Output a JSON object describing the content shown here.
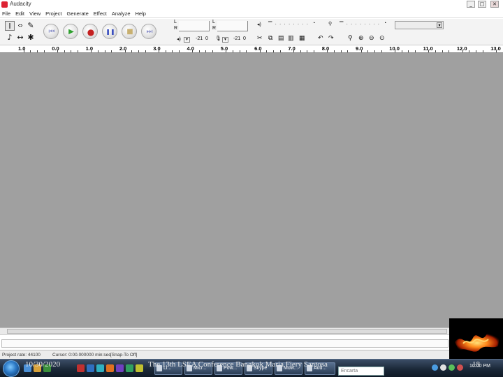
{
  "window": {
    "title": "Audacity",
    "minimize": "_",
    "maximize": "□",
    "close": "✕"
  },
  "menu": [
    "File",
    "Edit",
    "View",
    "Project",
    "Generate",
    "Effect",
    "Analyze",
    "Help"
  ],
  "tools": {
    "row1": [
      {
        "name": "selection-tool-icon",
        "glyph": "I",
        "selected": true
      },
      {
        "name": "envelope-tool-icon",
        "glyph": "⇔"
      },
      {
        "name": "draw-tool-icon",
        "glyph": "✎"
      }
    ],
    "row2": [
      {
        "name": "zoom-tool-icon",
        "glyph": "♪"
      },
      {
        "name": "timeshift-tool-icon",
        "glyph": "↔"
      },
      {
        "name": "multi-tool-icon",
        "glyph": "✱"
      }
    ]
  },
  "transport": [
    {
      "name": "skip-to-start-button",
      "glyph": "⏮",
      "color": "#8a8fc8"
    },
    {
      "name": "play-button",
      "glyph": "▶",
      "color": "#2fa02f"
    },
    {
      "name": "record-button",
      "glyph": "●",
      "color": "#c42020"
    },
    {
      "name": "pause-button",
      "glyph": "❚❚",
      "color": "#3a4fbf"
    },
    {
      "name": "stop-button",
      "glyph": "■",
      "color": "#c8b070"
    },
    {
      "name": "skip-to-end-button",
      "glyph": "⏭",
      "color": "#8a8fc8"
    }
  ],
  "meters": {
    "output": {
      "L": "L",
      "R": "R"
    },
    "input": {
      "L": "L",
      "R": "R"
    },
    "scale": [
      "-21",
      "0"
    ]
  },
  "ruler": {
    "ticks": [
      "1.0",
      "0.0",
      "1.0",
      "2.0",
      "3.0",
      "4.0",
      "5.0",
      "6.0",
      "7.0",
      "8.0",
      "9.0",
      "10.0",
      "11.0",
      "12.0",
      "13.0"
    ]
  },
  "status": {
    "project_rate": "Project rate: 44100",
    "cursor": "Cursor: 0:00.000000 min:sec",
    "snap": "[Snap-To Off]"
  },
  "slide_footer": {
    "date": "10/30/2020",
    "caption": "The 13th LSEA Conference Bangkok Maria Fiery Santosa",
    "page": "18"
  },
  "taskbar": {
    "buttons": [
      "Li...",
      "Micr...",
      "Pow...",
      "Skype",
      "Mow...",
      "Aud..."
    ],
    "search_placeholder": "Encarta",
    "time": "10:00 PM"
  },
  "colors": {
    "track_background": "#a0a0a0",
    "toolbar_background": "#f3f3f3"
  }
}
